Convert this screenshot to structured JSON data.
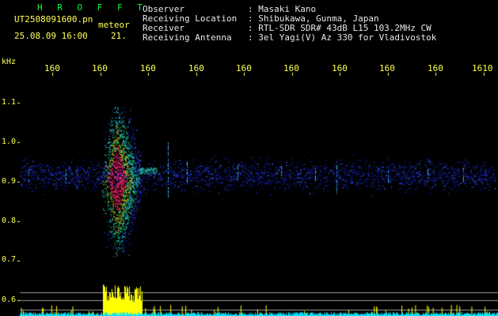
{
  "app": {
    "title": "H R O F F T",
    "file_name": "UT2508091600.pn",
    "meteor_label": "meteor",
    "date_time": "25.08.09 16:00",
    "count": "21."
  },
  "info": {
    "labels": [
      "Observer",
      "Receiving Location",
      "Receiver",
      "Receiving Antenna"
    ],
    "values": [
      ": Masaki Kano",
      ": Shibukawa, Gunma, Japan",
      ": RTL-SDR SDR# 43dB L15 103.2MHz CW",
      ": 3el Yagi(V) Az 330 for Vladivostok"
    ]
  },
  "axis": {
    "unit": "kHz",
    "y_ticks": [
      "1.1",
      "1.0",
      "0.9",
      "0.8",
      "0.7",
      "0.6"
    ],
    "x_ticks": [
      "160",
      "160",
      "160",
      "160",
      "160",
      "160",
      "160",
      "160",
      "160",
      "1610"
    ]
  },
  "colors": {
    "title": "#00ff3c",
    "text": "#ffff55",
    "info": "#e8e8e8",
    "background": "#000000",
    "noise": "#1a24c8",
    "signal_green": "#22d07a",
    "signal_red": "#ff2a6e",
    "spectrum": "#ffff00",
    "baseline": "#00e5ff"
  }
}
